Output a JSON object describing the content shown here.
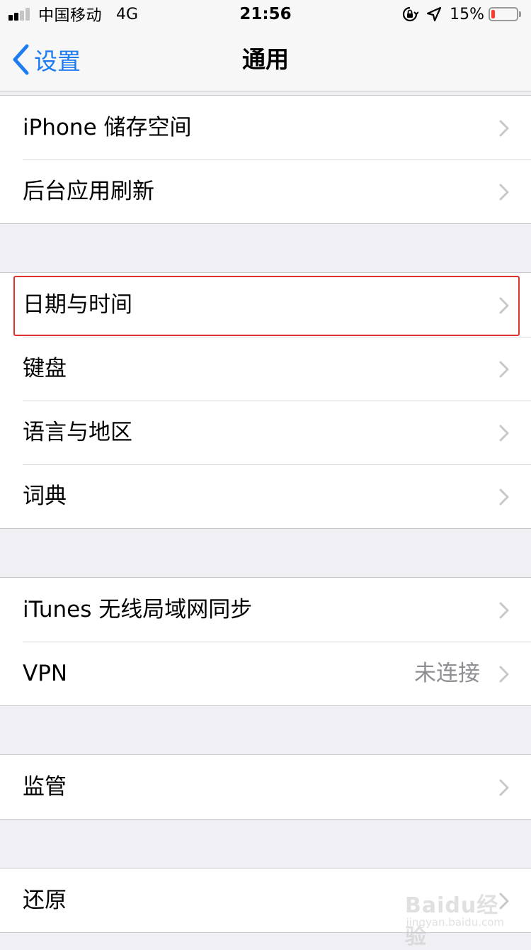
{
  "status_bar": {
    "carrier": "中国移动",
    "network": "4G",
    "time": "21:56",
    "battery_percent": "15%",
    "battery_level": 0.15,
    "signal_bars": 4,
    "signal_active": 2,
    "battery_color": "#ff3b30",
    "icons": [
      "rotation-lock-icon",
      "location-arrow-icon"
    ]
  },
  "nav": {
    "back_label": "设置",
    "title": "通用",
    "accent": "#1e7cf2"
  },
  "groups": [
    {
      "items": [
        {
          "label": "iPhone 储存空间",
          "detail": ""
        },
        {
          "label": "后台应用刷新",
          "detail": ""
        }
      ]
    },
    {
      "items": [
        {
          "label": "日期与时间",
          "detail": "",
          "highlighted": true
        },
        {
          "label": "键盘",
          "detail": ""
        },
        {
          "label": "语言与地区",
          "detail": ""
        },
        {
          "label": "词典",
          "detail": ""
        }
      ]
    },
    {
      "items": [
        {
          "label": "iTunes 无线局域网同步",
          "detail": ""
        },
        {
          "label": "VPN",
          "detail": "未连接"
        }
      ]
    },
    {
      "items": [
        {
          "label": "监管",
          "detail": ""
        }
      ]
    },
    {
      "items": [
        {
          "label": "还原",
          "detail": ""
        }
      ]
    }
  ],
  "watermark": {
    "brand": "Baidu经验",
    "url": "jingyan.baidu.com"
  }
}
